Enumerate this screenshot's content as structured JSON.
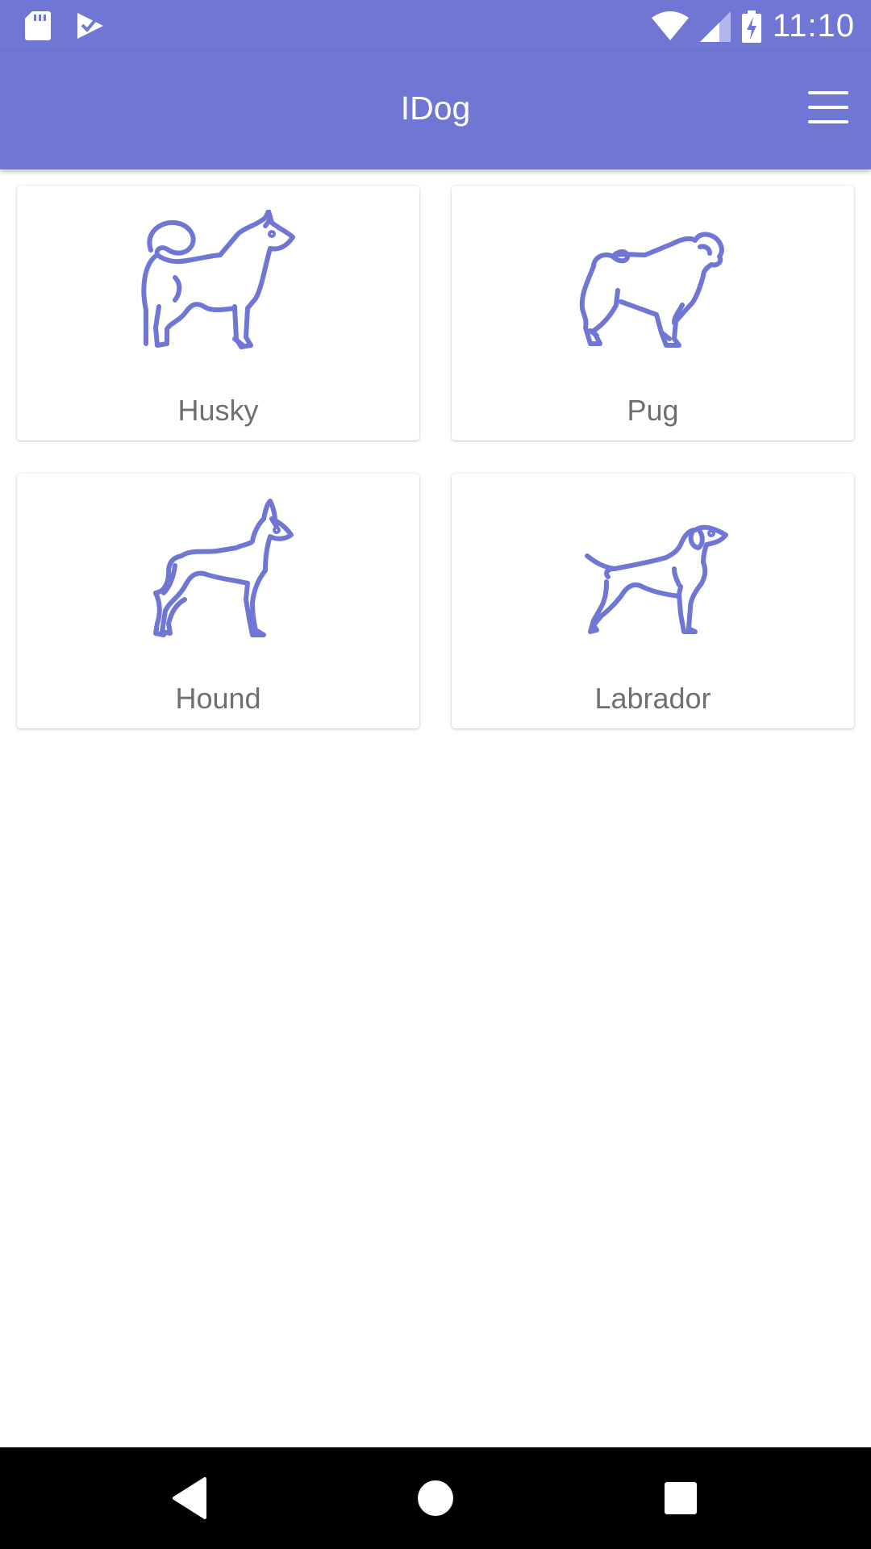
{
  "status_bar": {
    "time": "11:10",
    "icons": [
      "sd-card-icon",
      "task-check-icon",
      "wifi-icon",
      "signal-icon",
      "battery-charging-icon"
    ]
  },
  "app_bar": {
    "title": "IDog",
    "menu_icon": "hamburger-menu-icon"
  },
  "breeds": [
    {
      "label": "Husky",
      "icon": "husky-dog-icon"
    },
    {
      "label": "Pug",
      "icon": "pug-dog-icon"
    },
    {
      "label": "Hound",
      "icon": "hound-dog-icon"
    },
    {
      "label": "Labrador",
      "icon": "labrador-dog-icon"
    }
  ],
  "nav_bar": {
    "icons": [
      "back-icon",
      "home-icon",
      "recents-icon"
    ]
  },
  "colors": {
    "primary": "#7076d3",
    "card_label": "#6f6f6f",
    "nav_background": "#000000"
  }
}
